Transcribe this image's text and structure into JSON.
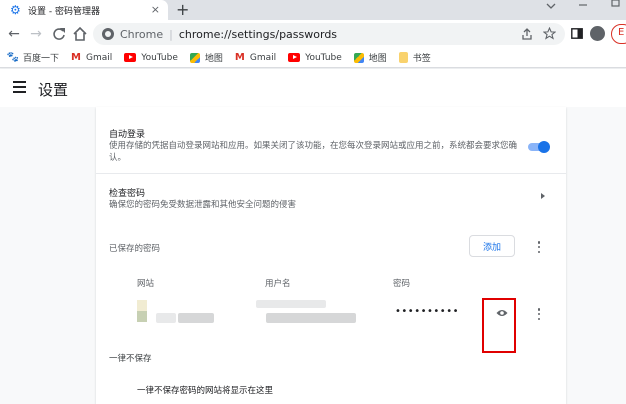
{
  "tab": {
    "title": "设置 - 密码管理器",
    "close": "×"
  },
  "newtab": "+",
  "toolbar": {
    "back": "←",
    "forward": "→",
    "reload": "C",
    "home": "⌂",
    "url_scheme": "Chrome",
    "url_separator": "|",
    "url": "chrome://settings/passwords",
    "profile_badge": "E"
  },
  "bookmarks": [
    {
      "icon": "baidu-icon",
      "label": "百度一下"
    },
    {
      "icon": "gmail-icon",
      "label": "Gmail"
    },
    {
      "icon": "youtube-icon",
      "label": "YouTube"
    },
    {
      "icon": "maps-icon",
      "label": "地图"
    },
    {
      "icon": "gmail-icon",
      "label": "Gmail"
    },
    {
      "icon": "youtube-icon",
      "label": "YouTube"
    },
    {
      "icon": "maps-icon",
      "label": "地图"
    },
    {
      "icon": "folder-icon",
      "label": "书签"
    }
  ],
  "header": {
    "title": "设置"
  },
  "autologin": {
    "title": "自动登录",
    "description": "使用存储的凭据自动登录网站和应用。如果关闭了该功能，在您每次登录网站或应用之前，系统都会要求您确认。",
    "enabled": true
  },
  "check": {
    "title": "检查密码",
    "description": "确保您的密码免受数据泄露和其他安全问题的侵害"
  },
  "saved": {
    "title": "已保存的密码",
    "add_label": "添加",
    "columns": {
      "site": "网站",
      "username": "用户名",
      "password": "密码"
    },
    "entry": {
      "password_masked": "••••••••••"
    }
  },
  "never": {
    "title": "一律不保存",
    "empty": "一律不保存密码的网站将显示在这里"
  },
  "colors": {
    "accent": "#1a73e8",
    "highlight": "#e00000"
  }
}
